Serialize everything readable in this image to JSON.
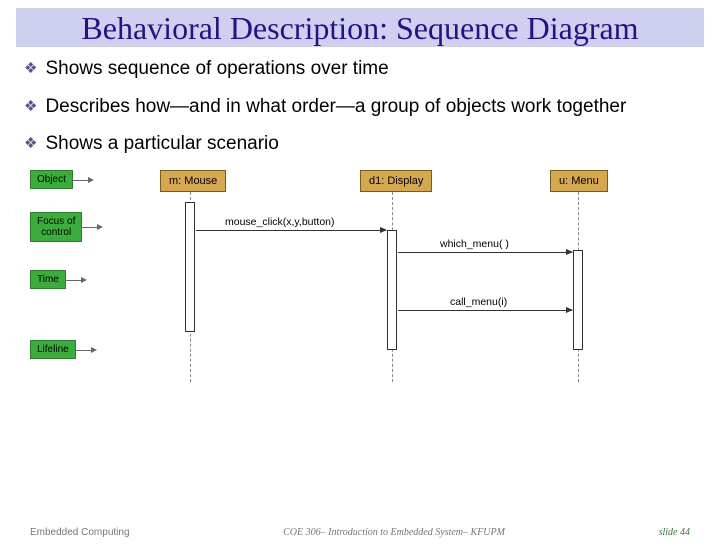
{
  "title": "Behavioral Description: Sequence Diagram",
  "bullets": [
    "Shows sequence of operations over time",
    "Describes how—and in what order—a group of objects work together",
    "Shows a particular scenario"
  ],
  "legend": {
    "object": "Object",
    "focus": "Focus of\ncontrol",
    "time": "Time",
    "lifeline": "Lifeline"
  },
  "objects": {
    "mouse": "m: Mouse",
    "display": "d1: Display",
    "menu": "u: Menu"
  },
  "messages": {
    "mouse_click": "mouse_click(x,y,button)",
    "which_menu": "which_menu( )",
    "call_menu": "call_menu(i)"
  },
  "footer": {
    "left": "Embedded Computing",
    "mid": "COE 306– Introduction to Embedded System– KFUPM",
    "right": "slide 44"
  }
}
